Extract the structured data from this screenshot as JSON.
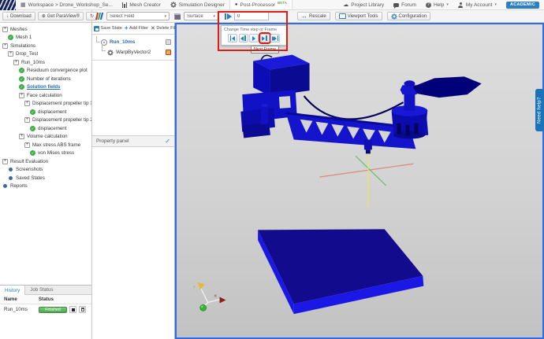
{
  "topbar": {
    "workspace_label": "Workspace > Drone_Workshop_Se...",
    "tabs": [
      {
        "label": "Mesh Creator"
      },
      {
        "label": "Simulation Designer"
      },
      {
        "label": "Post-Processor",
        "badge": "BETA"
      }
    ],
    "links": {
      "project_library": "Project Library",
      "forum": "Forum",
      "help": "Help",
      "my_account": "My Account",
      "account_badge": "ACADEMIC"
    }
  },
  "toolbar": {
    "download_label": "Download",
    "get_paraview_label": "Get ParaView®",
    "select_field_value": "Select Field",
    "representation_value": "Surface",
    "frame_input_value": "0",
    "rescale_label": "Rescale",
    "viewport_tools_label": "Viewport Tools",
    "configuration_label": "Configuration"
  },
  "frame_popup": {
    "title": "Change Time step or Frame",
    "buttons": [
      "first-frame",
      "previous-frame",
      "play",
      "next-frame",
      "last-frame"
    ],
    "tooltip": "Next Frame"
  },
  "sidebar_tree": {
    "items": [
      {
        "label": "Meshes",
        "level": 0,
        "icon": "expand"
      },
      {
        "label": "Mesh 1",
        "level": 1,
        "icon": "check"
      },
      {
        "label": "Simulations",
        "level": 0,
        "icon": "expand"
      },
      {
        "label": "Drop_Test",
        "level": 1,
        "icon": "expand"
      },
      {
        "label": "Run_10ms",
        "level": 2,
        "icon": "expand"
      },
      {
        "label": "Residuum convergence plot",
        "level": 3,
        "icon": "check"
      },
      {
        "label": "Number of iterations",
        "level": 3,
        "icon": "check"
      },
      {
        "label": "Solution fields",
        "level": 3,
        "icon": "check",
        "selected": true
      },
      {
        "label": "Face calculation",
        "level": 3,
        "icon": "expand"
      },
      {
        "label": "Displacement propeller tip 1",
        "level": 4,
        "icon": "expand"
      },
      {
        "label": "displacement",
        "level": 5,
        "icon": "check"
      },
      {
        "label": "Displacement propeller tip 2",
        "level": 4,
        "icon": "expand"
      },
      {
        "label": "displacement",
        "level": 5,
        "icon": "check"
      },
      {
        "label": "Volume calculation",
        "level": 3,
        "icon": "expand"
      },
      {
        "label": "Max stress ABS frame",
        "level": 4,
        "icon": "expand"
      },
      {
        "label": "von Mises stress",
        "level": 5,
        "icon": "check"
      },
      {
        "label": "Result Evaluation",
        "level": 0,
        "icon": "expand"
      },
      {
        "label": "Screenshots",
        "level": 1,
        "icon": "dot"
      },
      {
        "label": "Saved States",
        "level": 1,
        "icon": "dot"
      },
      {
        "label": "Reports",
        "level": 0,
        "icon": "dot"
      }
    ]
  },
  "filter_panel": {
    "save_state_label": "Save State",
    "add_filter_label": "Add Filter",
    "delete_filter_label": "Delete Filter",
    "pipeline": [
      {
        "label": "Run_10ms"
      },
      {
        "label": "WarpByVector2"
      }
    ],
    "property_panel_label": "Property panel"
  },
  "history_panel": {
    "tabs": [
      "History",
      "Job Status"
    ],
    "columns": [
      "Name",
      "Status"
    ],
    "rows": [
      {
        "name": "Run_10ms",
        "status": "Finished"
      }
    ]
  },
  "viewport": {
    "need_help_label": "Need help?",
    "axis_labels": {
      "y": "Y",
      "x": "X"
    }
  },
  "icons": {
    "caret_down": "▾",
    "check": "✓",
    "plus": "+",
    "close": "✕",
    "download_arrow": "↓",
    "refresh": "↻",
    "cloud": "☁",
    "globe": "⊕",
    "question": "?",
    "arrows_lr": "↔",
    "grid": "▦",
    "circle": "●"
  },
  "colors": {
    "highlight_red": "#e01d15",
    "accent_blue": "#2a7fbf",
    "status_green": "#55b455",
    "model_blue": "#1414cc",
    "viewport_border_blue": "#2e6ee0",
    "academic_badge_blue": "#2e7fc2",
    "need_help_blue": "#1b74b8"
  }
}
